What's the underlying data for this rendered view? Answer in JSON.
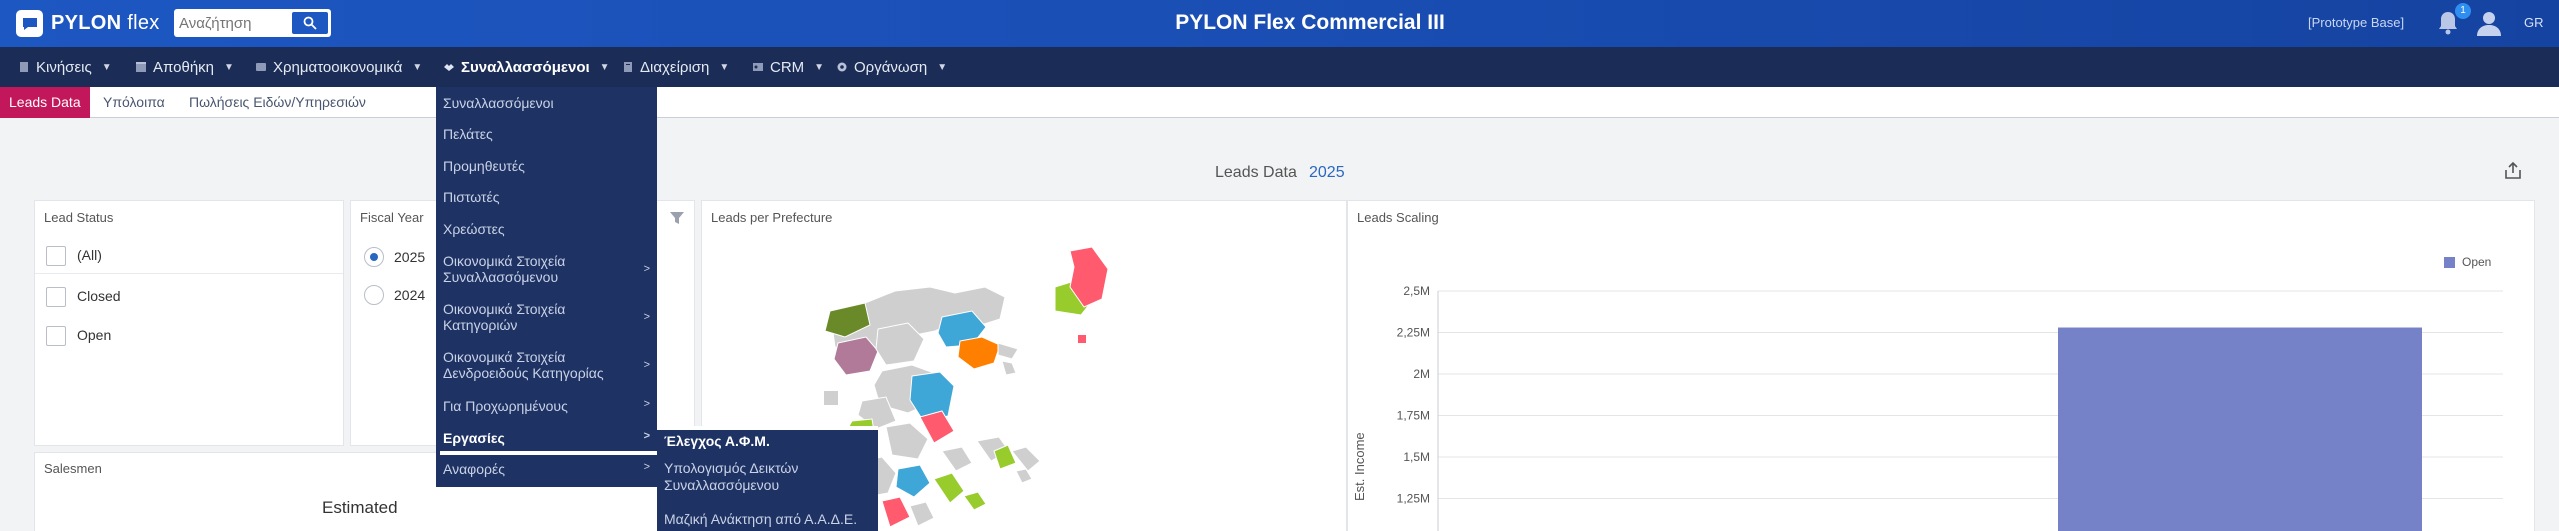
{
  "header": {
    "logo_text": "PYLON",
    "logo_suffix": "flex",
    "search_placeholder": "Αναζήτηση",
    "title": "PYLON Flex Commercial III",
    "prototype": "[Prototype Base]",
    "notif_count": "1",
    "lang": "GR"
  },
  "nav": [
    {
      "label": "Κινήσεις"
    },
    {
      "label": "Αποθήκη"
    },
    {
      "label": "Χρηματοοικονομικά"
    },
    {
      "label": "Συναλλασσόμενοι"
    },
    {
      "label": "Διαχείριση"
    },
    {
      "label": "CRM"
    },
    {
      "label": "Οργάνωση"
    }
  ],
  "subtabs": [
    {
      "label": "Leads Data"
    },
    {
      "label": "Υπόλοιπα"
    },
    {
      "label": "Πωλήσεις Ειδών/Υπηρεσιών"
    }
  ],
  "dashboard": {
    "title": "Leads Data",
    "year": "2025"
  },
  "lead_status": {
    "title": "Lead Status",
    "options": [
      "(All)",
      "Closed",
      "Open"
    ]
  },
  "fiscal_year": {
    "title": "Fiscal Year",
    "options": [
      "2025",
      "2024"
    ],
    "selected": "2025"
  },
  "map_panel": {
    "title": "Leads per Prefecture"
  },
  "scaling_panel": {
    "title": "Leads Scaling",
    "legend": "Open",
    "y_label": "Est. Income"
  },
  "salesmen_panel": {
    "title": "Salesmen",
    "estimated": "Estimated"
  },
  "menu": {
    "items": [
      {
        "label": "Συναλλασσόμενοι",
        "sub": false
      },
      {
        "label": "Πελάτες",
        "sub": false
      },
      {
        "label": "Προμηθευτές",
        "sub": false
      },
      {
        "label": "Πιστωτές",
        "sub": false
      },
      {
        "label": "Χρεώστες",
        "sub": false
      },
      {
        "label": "Οικονομικά Στοιχεία Συναλλασσόμενου",
        "sub": true
      },
      {
        "label": "Οικονομικά Στοιχεία Κατηγοριών",
        "sub": true
      },
      {
        "label": "Οικονομικά Στοιχεία Δενδροειδούς Κατηγορίας",
        "sub": true
      },
      {
        "label": "Για Προχωρημένους",
        "sub": true
      },
      {
        "label": "Εργασίες",
        "sub": true
      },
      {
        "label": "Αναφορές",
        "sub": true
      }
    ],
    "submenu": [
      {
        "label": "Έλεγχος Α.Φ.Μ."
      },
      {
        "label": "Υπολογισμός Δεικτών Συναλλασσόμενου"
      },
      {
        "label": "Μαζική Ανάκτηση από Α.Α.Δ.Ε."
      }
    ]
  },
  "colors": {
    "header": "#1d57c2",
    "nav": "#1b2d57",
    "menu": "#1e3263",
    "accent_tab": "#c2185b",
    "bar": "#7682c8"
  },
  "chart_data": {
    "type": "bar",
    "title": "Leads Scaling",
    "series": [
      {
        "name": "Open",
        "values": [
          2.28
        ]
      }
    ],
    "ylabel": "Est. Income",
    "yticks": [
      "1,25M",
      "1,5M",
      "1,75M",
      "2M",
      "2,25M",
      "2,5M"
    ],
    "ylim": [
      1.0,
      2.5
    ],
    "legend": "top-right",
    "grid": true
  }
}
